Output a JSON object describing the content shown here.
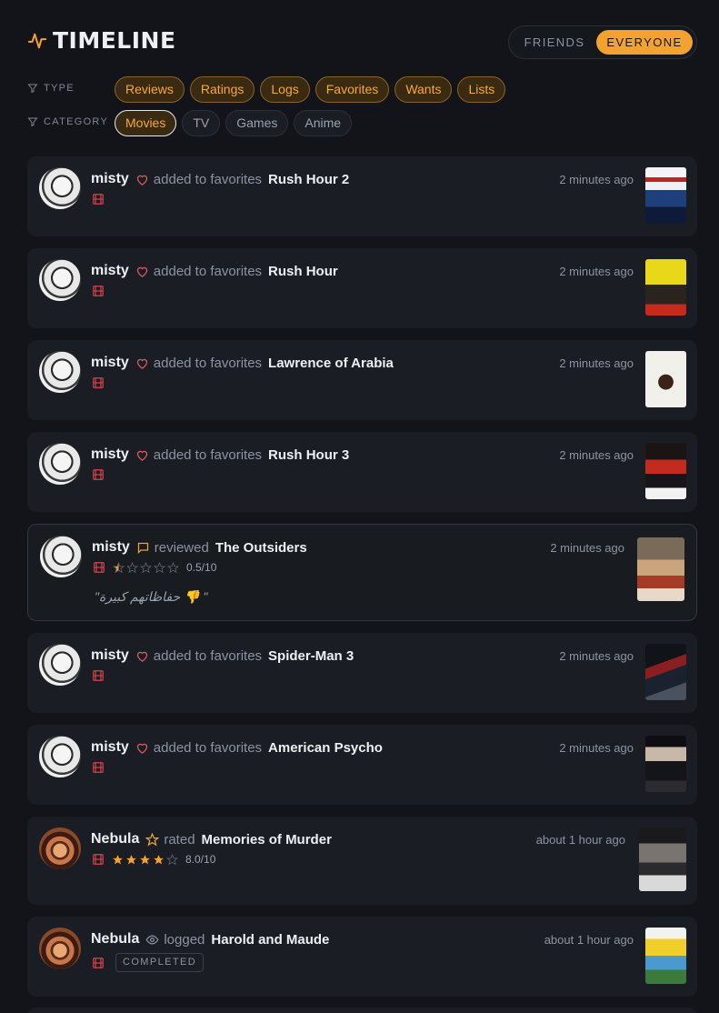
{
  "header": {
    "title": "TIMELINE",
    "toggle": {
      "friends": "FRIENDS",
      "everyone": "EVERYONE",
      "selected": "EVERYONE"
    }
  },
  "filters": {
    "type": {
      "label": "TYPE",
      "options": [
        "Reviews",
        "Ratings",
        "Logs",
        "Favorites",
        "Wants",
        "Lists"
      ]
    },
    "category": {
      "label": "CATEGORY",
      "options": [
        "Movies",
        "TV",
        "Games",
        "Anime"
      ],
      "selected": "Movies"
    }
  },
  "colors": {
    "accent": "#f2a22e",
    "heart": "#e05a63",
    "film": "#d9434d",
    "background": "#121419",
    "card": "#1a1d23"
  },
  "feed": [
    {
      "user": "misty",
      "action_icon": "heart-icon",
      "action": "added to favorites",
      "title": "Rush Hour 2",
      "time": "2 minutes ago"
    },
    {
      "user": "misty",
      "action_icon": "heart-icon",
      "action": "added to favorites",
      "title": "Rush Hour",
      "time": "2 minutes ago"
    },
    {
      "user": "misty",
      "action_icon": "heart-icon",
      "action": "added to favorites",
      "title": "Lawrence of Arabia",
      "time": "2 minutes ago"
    },
    {
      "user": "misty",
      "action_icon": "heart-icon",
      "action": "added to favorites",
      "title": "Rush Hour 3",
      "time": "2 minutes ago"
    },
    {
      "user": "misty",
      "action_icon": "comment-icon",
      "action": "reviewed",
      "title": "The Outsiders",
      "time": "2 minutes ago",
      "rating": 0.5,
      "score": "0.5/10",
      "quote": "\"حفاظاتهم كبيرة 👎 \""
    },
    {
      "user": "misty",
      "action_icon": "heart-icon",
      "action": "added to favorites",
      "title": "Spider-Man 3",
      "time": "2 minutes ago"
    },
    {
      "user": "misty",
      "action_icon": "heart-icon",
      "action": "added to favorites",
      "title": "American Psycho",
      "time": "2 minutes ago"
    },
    {
      "user": "Nebula",
      "action_icon": "star-icon",
      "action": "rated",
      "title": "Memories of Murder",
      "time": "about 1 hour ago",
      "rating": 4,
      "score": "8.0/10"
    },
    {
      "user": "Nebula",
      "action_icon": "eye-icon",
      "action": "logged",
      "title": "Harold and Maude",
      "time": "about 1 hour ago",
      "badge": "COMPLETED"
    }
  ]
}
